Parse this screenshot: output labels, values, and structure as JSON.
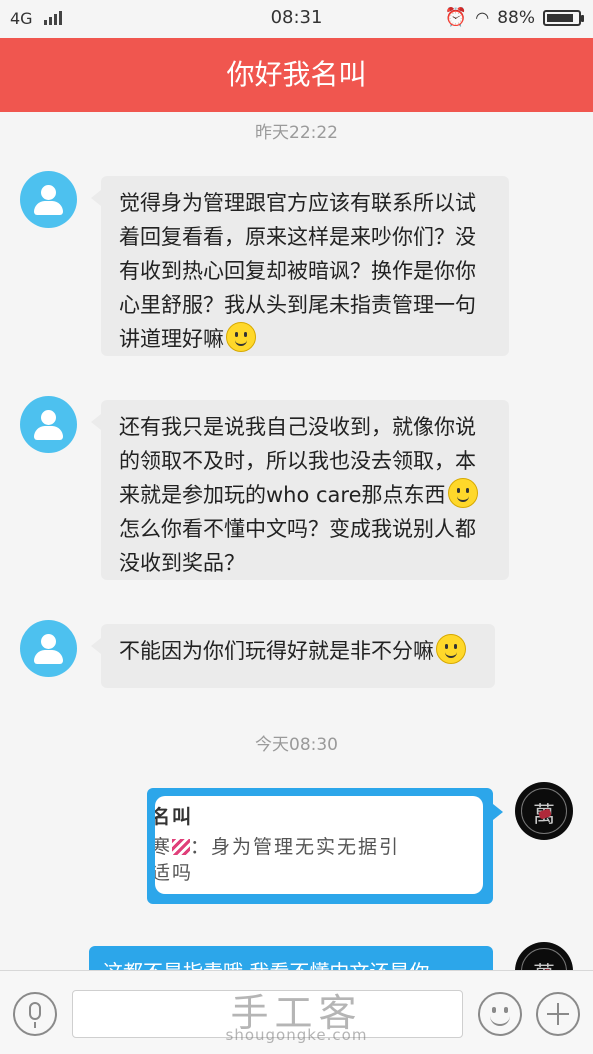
{
  "status_bar": {
    "network": "4G",
    "time": "08:31",
    "battery": "88%",
    "battery_level": 0.88
  },
  "header": {
    "title": "你好我名叫"
  },
  "timestamps": {
    "yesterday": "昨天22:22",
    "today": "今天08:30"
  },
  "messages": [
    {
      "lines": [
        "觉得身为管理跟官方应该有联系所以试",
        "着回复看看，原来这样是来吵你们？没",
        "有收到热心回复却被暗讽？换作是你你",
        "心里舒服？我从头到尾未指责管理一句",
        "讲道理好嘛"
      ]
    },
    {
      "lines": [
        "还有我只是说我自己没收到，就像你说",
        "的领取不及时，所以我也没去领取，本",
        "来就是参加玩的who care那点东西",
        "怎么你看不懂中文吗？变成我说别人都",
        "没收到奖品？"
      ]
    },
    {
      "lines": [
        "不能因为你们玩得好就是非不分嘛"
      ]
    }
  ],
  "quote": {
    "line1": "名叫",
    "line2_prefix": "寒",
    "line2_text": "：身为管理无实无据引",
    "line3": "适吗"
  },
  "outgoing_partial": "这都不是指责哦 我看不懂中文还是你",
  "avatar_me": {
    "glyph": "萬"
  },
  "input": {
    "value": ""
  },
  "watermark": {
    "title": "手工客",
    "domain": "shougongke.com"
  }
}
